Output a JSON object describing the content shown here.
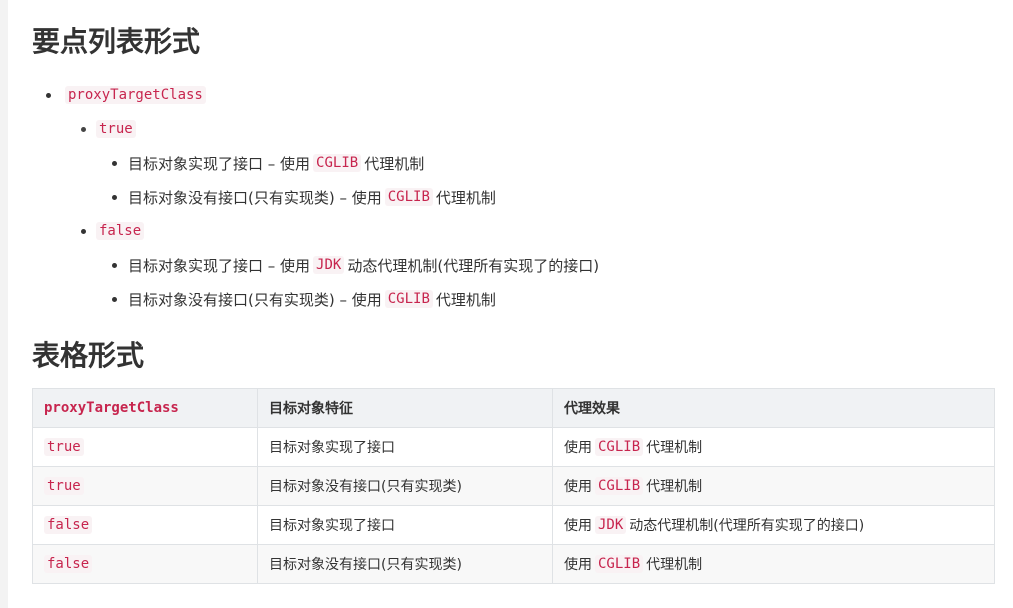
{
  "headings": {
    "list": "要点列表形式",
    "table": "表格形式"
  },
  "list": {
    "root_code": "proxyTargetClass",
    "true_code": "true",
    "false_code": "false",
    "true_items": [
      {
        "prefix": "目标对象实现了接口 – 使用",
        "code": "CGLIB",
        "suffix": "代理机制"
      },
      {
        "prefix": "目标对象没有接口(只有实现类) – 使用",
        "code": "CGLIB",
        "suffix": "代理机制"
      }
    ],
    "false_items": [
      {
        "prefix": "目标对象实现了接口 – 使用",
        "code": "JDK",
        "suffix": "动态代理机制(代理所有实现了的接口)"
      },
      {
        "prefix": "目标对象没有接口(只有实现类) – 使用",
        "code": "CGLIB",
        "suffix": "代理机制"
      }
    ]
  },
  "table": {
    "headers": [
      "proxyTargetClass",
      "目标对象特征",
      "代理效果"
    ],
    "rows": [
      {
        "value": "true",
        "feature": "目标对象实现了接口",
        "effect_prefix": "使用",
        "effect_code": "CGLIB",
        "effect_suffix": "代理机制"
      },
      {
        "value": "true",
        "feature": "目标对象没有接口(只有实现类)",
        "effect_prefix": "使用",
        "effect_code": "CGLIB",
        "effect_suffix": "代理机制"
      },
      {
        "value": "false",
        "feature": "目标对象实现了接口",
        "effect_prefix": "使用",
        "effect_code": "JDK",
        "effect_suffix": "动态代理机制(代理所有实现了的接口)"
      },
      {
        "value": "false",
        "feature": "目标对象没有接口(只有实现类)",
        "effect_prefix": "使用",
        "effect_code": "CGLIB",
        "effect_suffix": "代理机制"
      }
    ]
  }
}
